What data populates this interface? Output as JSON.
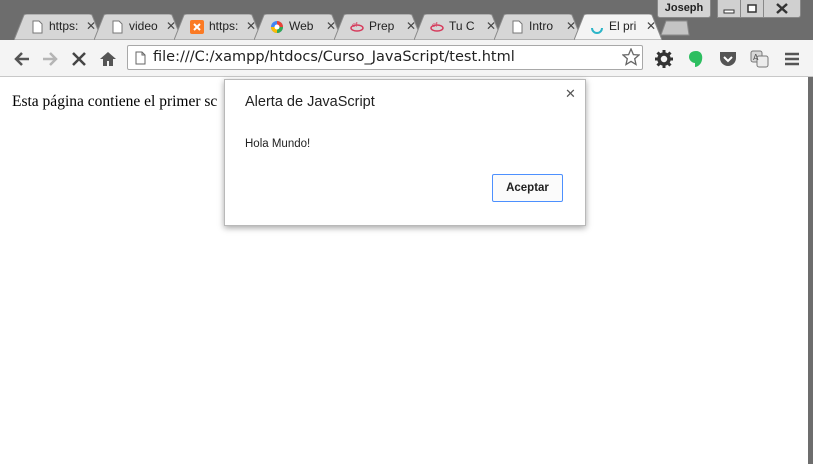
{
  "window": {
    "user": "Joseph",
    "tabs": [
      {
        "title": "https:",
        "icon": "page-icon"
      },
      {
        "title": "video",
        "icon": "page-icon"
      },
      {
        "title": "https:",
        "icon": "xampp-icon"
      },
      {
        "title": "Web",
        "icon": "webstore-icon"
      },
      {
        "title": "Prep",
        "icon": "codigofacilito-icon"
      },
      {
        "title": "Tu C",
        "icon": "codigofacilito-icon"
      },
      {
        "title": "Intro",
        "icon": "page-icon"
      },
      {
        "title": "El pri",
        "icon": "loading-spinner-icon",
        "active": true
      }
    ]
  },
  "toolbar": {
    "url": "file:///C:/xampp/htdocs/Curso_JavaScript/test.html"
  },
  "page": {
    "text": "Esta página contiene el primer sc"
  },
  "dialog": {
    "title": "Alerta de JavaScript",
    "message": "Hola Mundo!",
    "ok_label": "Aceptar",
    "accent_color": "#4d90fe"
  }
}
